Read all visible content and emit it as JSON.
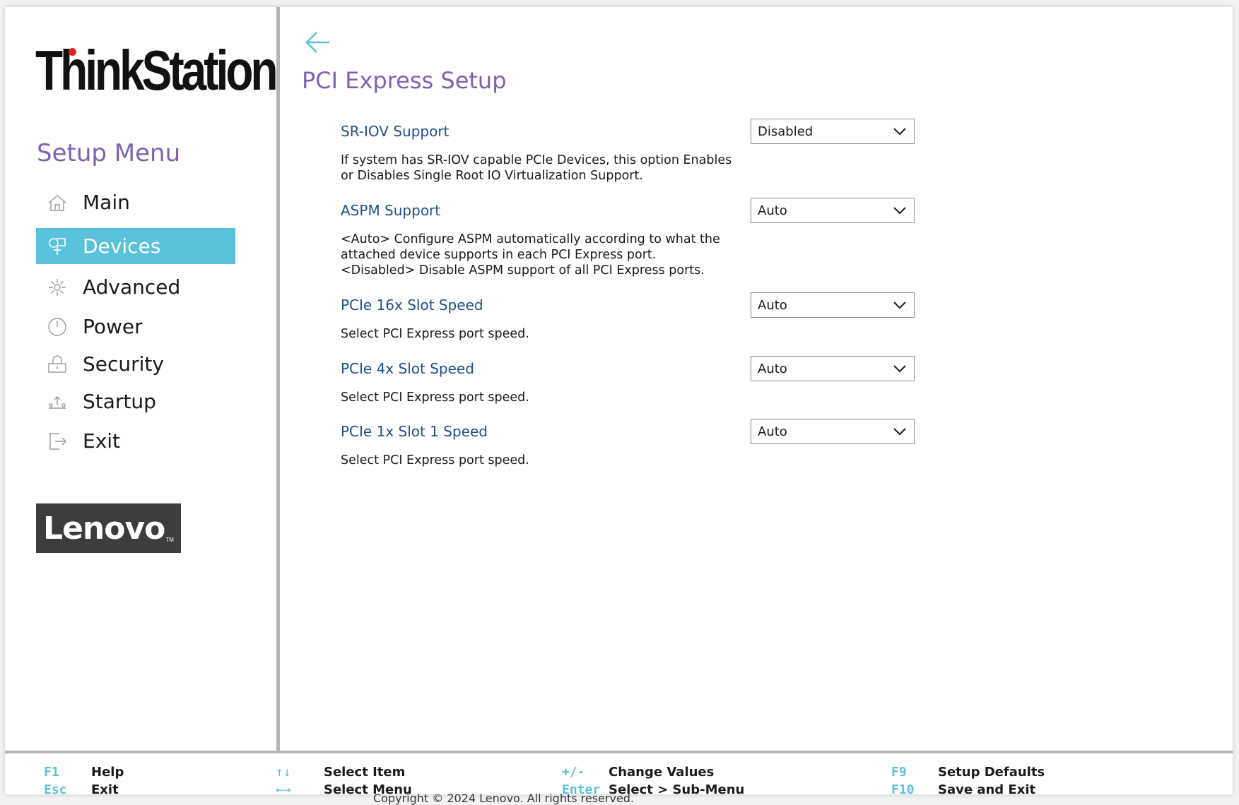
{
  "brand": {
    "product": "ThinkStation",
    "vendor_logo": "Lenovo"
  },
  "sidebar": {
    "title": "Setup Menu",
    "items": [
      {
        "label": "Main",
        "icon": "home-icon",
        "active": false
      },
      {
        "label": "Devices",
        "icon": "devices-icon",
        "active": true
      },
      {
        "label": "Advanced",
        "icon": "advanced-icon",
        "active": false
      },
      {
        "label": "Power",
        "icon": "power-icon",
        "active": false
      },
      {
        "label": "Security",
        "icon": "lock-icon",
        "active": false
      },
      {
        "label": "Startup",
        "icon": "startup-icon",
        "active": false
      },
      {
        "label": "Exit",
        "icon": "exit-icon",
        "active": false
      }
    ]
  },
  "page": {
    "title": "PCI Express Setup"
  },
  "settings": [
    {
      "title": "SR-IOV Support",
      "description": "If system has SR-IOV capable PCIe Devices, this option Enables\nor Disables Single Root IO Virtualization Support.",
      "value": "Disabled"
    },
    {
      "title": "ASPM Support",
      "description": "<Auto> Configure ASPM automatically according to what the\nattached device supports in each PCI Express port.\n<Disabled> Disable ASPM support of all PCI Express ports.",
      "value": "Auto"
    },
    {
      "title": "PCIe 16x Slot Speed",
      "description": "Select PCI Express port speed.",
      "value": "Auto"
    },
    {
      "title": "PCIe 4x Slot Speed",
      "description": "Select PCI Express port speed.",
      "value": "Auto"
    },
    {
      "title": "PCIe 1x Slot 1 Speed",
      "description": "Select PCI Express port speed.",
      "value": "Auto"
    }
  ],
  "footer": {
    "f1_key": "F1",
    "f1_text": "Help",
    "esc_key": "Esc",
    "esc_text": "Exit",
    "updown_key": "↑↓",
    "updown_text": "Select Item",
    "leftright_key": "←→",
    "leftright_text": "Select Menu",
    "plusminus_key": "+/-",
    "plusminus_text": "Change Values",
    "enter_key": "Enter",
    "enter_text": "Select > Sub-Menu",
    "f9_key": "F9",
    "f9_text": "Setup Defaults",
    "f10_key": "F10",
    "f10_text": "Save and Exit",
    "copyright": "Copyright © 2024 Lenovo. All rights reserved."
  },
  "colors": {
    "accent": "#5bc2dc",
    "title_purple": "#7e62b2",
    "setting_blue": "#1f4f8a"
  }
}
